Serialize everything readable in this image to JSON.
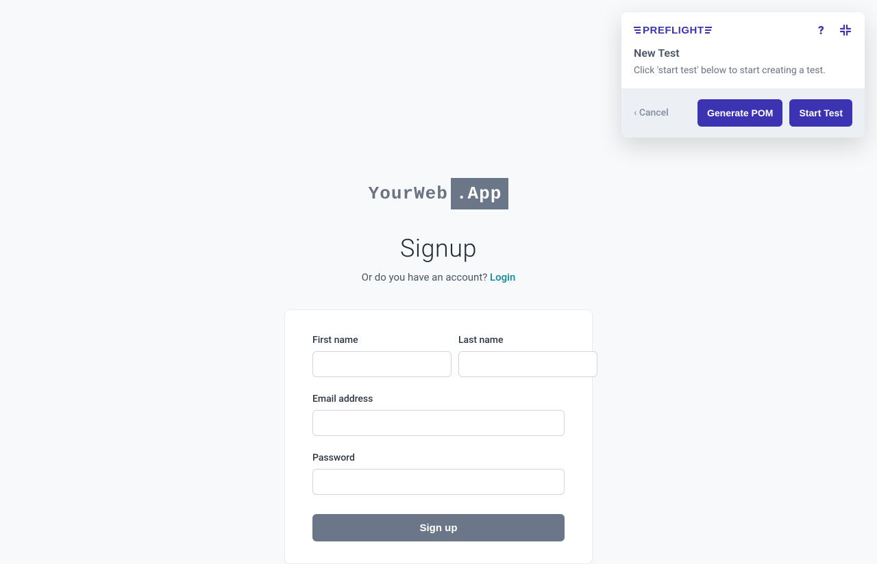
{
  "preflight": {
    "logo_text": "PREFLIGHT",
    "title": "New Test",
    "subtitle": "Click 'start test' below to start creating a test.",
    "cancel_label": "‹ Cancel",
    "generate_pom_label": "Generate POM",
    "start_test_label": "Start Test"
  },
  "app": {
    "logo_left": "YourWeb",
    "logo_right": ".App",
    "heading": "Signup",
    "sub_text": "Or do you have an account? ",
    "login_label": "Login"
  },
  "form": {
    "first_name_label": "First name",
    "last_name_label": "Last name",
    "email_label": "Email address",
    "password_label": "Password",
    "first_name_value": "",
    "last_name_value": "",
    "email_value": "",
    "password_value": "",
    "submit_label": "Sign up"
  }
}
